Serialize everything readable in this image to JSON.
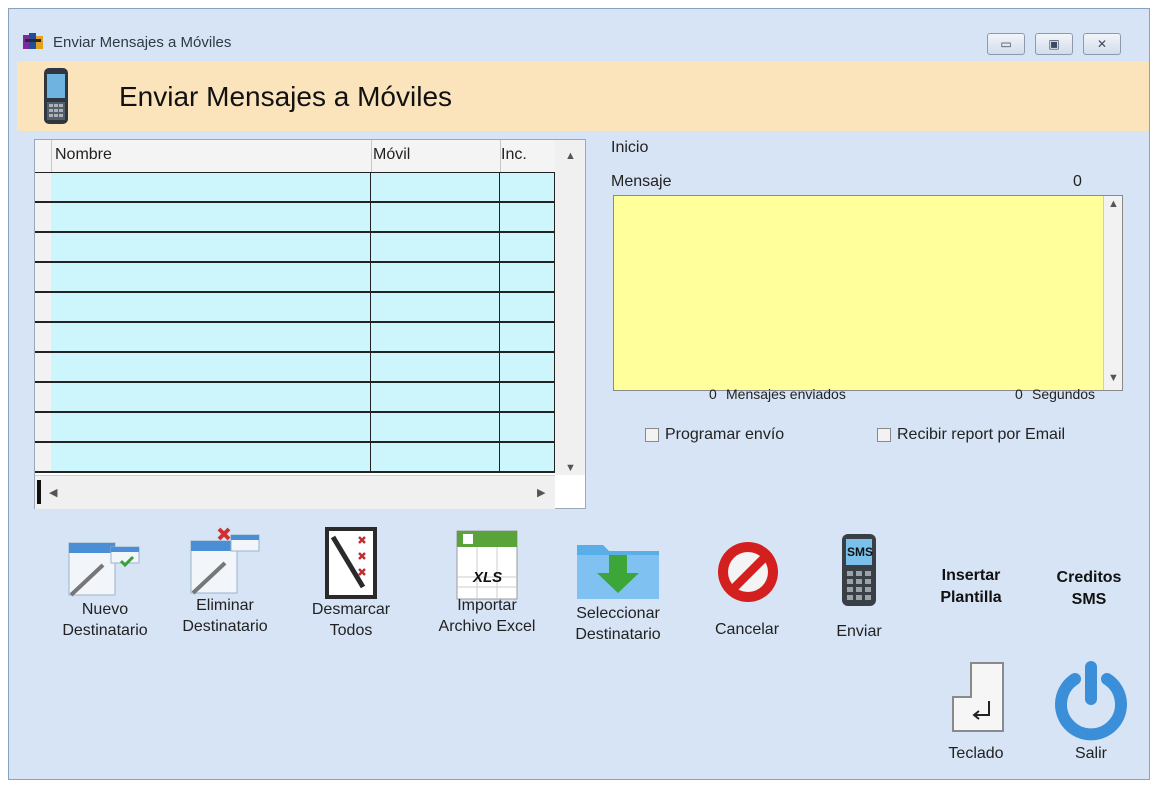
{
  "window": {
    "title": "Enviar Mensajes a Móviles",
    "controls": {
      "minimize": "▭",
      "maximize": "▣",
      "close": "✕"
    }
  },
  "banner": {
    "title": "Enviar Mensajes a Móviles",
    "icon": "mobile-phone-icon"
  },
  "grid": {
    "columns": [
      "Nombre",
      "Móvil",
      "Inc."
    ],
    "rows": [
      [
        "",
        "",
        ""
      ],
      [
        "",
        "",
        ""
      ],
      [
        "",
        "",
        ""
      ],
      [
        "",
        "",
        ""
      ],
      [
        "",
        "",
        ""
      ],
      [
        "",
        "",
        ""
      ],
      [
        "",
        "",
        ""
      ],
      [
        "",
        "",
        ""
      ],
      [
        "",
        "",
        ""
      ],
      [
        "",
        "",
        ""
      ]
    ]
  },
  "message_panel": {
    "section_label": "Inicio",
    "message_label": "Mensaje",
    "char_count": "0",
    "message_value": "",
    "sent_count": "0",
    "sent_label": "Mensajes enviados",
    "seconds_count": "0",
    "seconds_label": "Segundos",
    "schedule_label": "Programar envío",
    "schedule_checked": false,
    "report_label": "Recibir report por Email",
    "report_checked": false
  },
  "toolbar": {
    "new_recipient": "Nuevo\nDestinatario",
    "delete_recipient": "Eliminar\nDestinatario",
    "unmark_all": "Desmarcar\nTodos",
    "import_excel": "Importar\nArchivo Excel",
    "xls_badge": "XLS",
    "select_recipient": "Seleccionar\nDestinatario",
    "cancel": "Cancelar",
    "send": "Enviar",
    "sms_badge": "SMS",
    "insert_template": "Insertar\nPlantilla",
    "credits": "Creditos\nSMS",
    "keyboard": "Teclado",
    "exit": "Salir"
  },
  "colors": {
    "window_bg": "#d6e4f5",
    "banner_bg": "#fbe3bc",
    "grid_cell": "#ccf6fc",
    "message_bg": "#ffff9c"
  }
}
